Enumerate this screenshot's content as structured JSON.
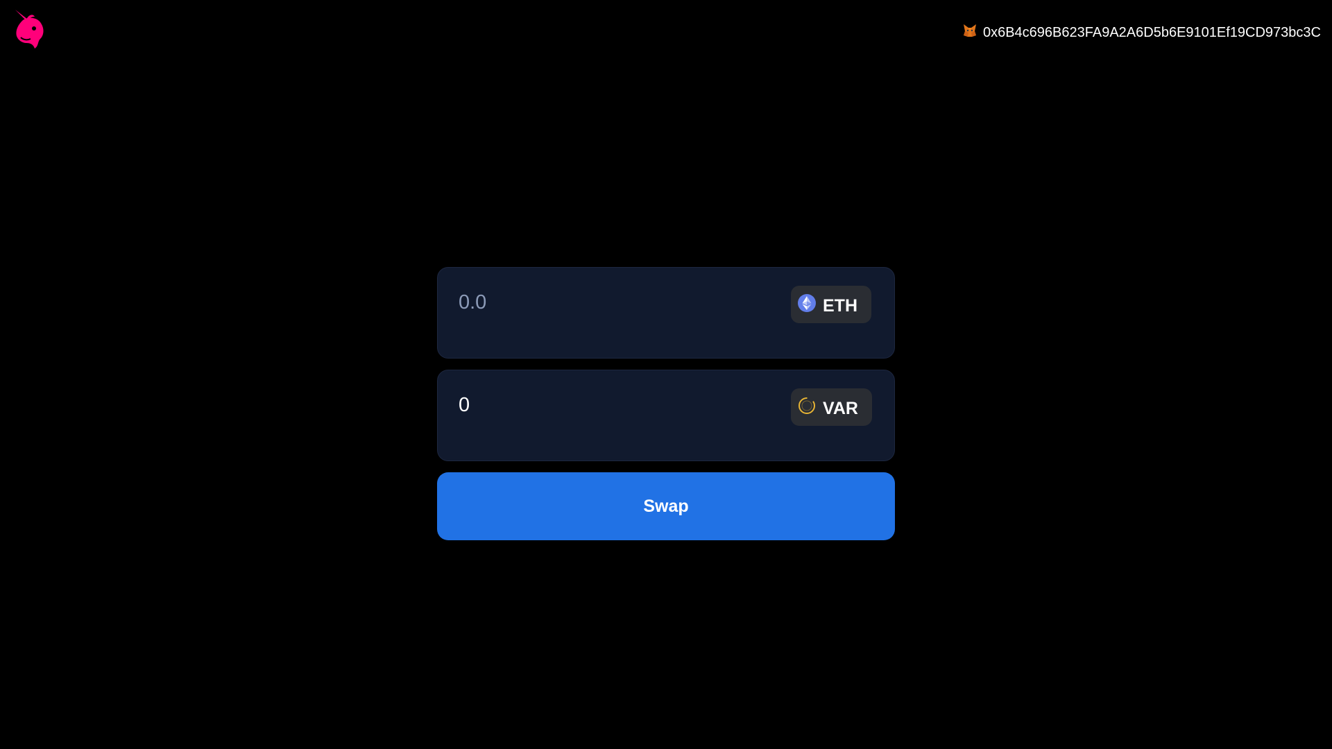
{
  "header": {
    "logo_icon": "uniswap-unicorn-icon",
    "wallet_icon": "metamask-fox-icon",
    "wallet_address": "0x6B4c696B623FA9A2A6D5b6E9101Ef19CD973bc3C"
  },
  "swap": {
    "from": {
      "amount_value": "",
      "amount_placeholder": "0.0",
      "token_symbol": "ETH",
      "token_icon": "ethereum-icon"
    },
    "to": {
      "amount_value": "0",
      "amount_placeholder": "",
      "token_symbol": "VAR",
      "token_icon": "var-token-icon"
    },
    "button_label": "Swap"
  },
  "colors": {
    "background": "#000000",
    "card_background": "#111a2e",
    "token_pill": "#2a2d33",
    "accent_blue": "#2172e5",
    "brand_pink": "#ff007a",
    "placeholder": "#8c9bb8"
  }
}
